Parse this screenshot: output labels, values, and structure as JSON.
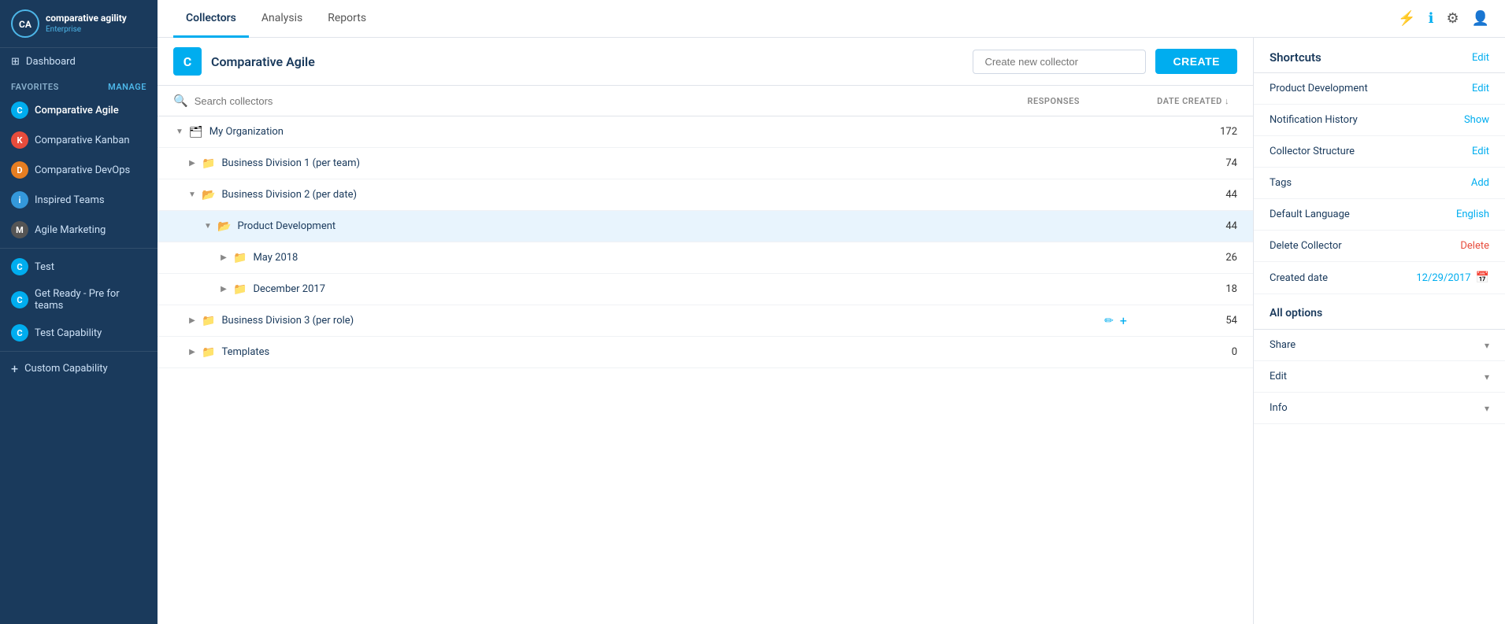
{
  "app": {
    "name": "comparative agility",
    "sub": "Enterprise"
  },
  "sidebar": {
    "dashboard_label": "Dashboard",
    "favorites_label": "FAVORITES",
    "manage_label": "Manage",
    "items": [
      {
        "id": "comparative-agile",
        "label": "Comparative Agile",
        "color": "#00adef",
        "initial": "C"
      },
      {
        "id": "comparative-kanban",
        "label": "Comparative Kanban",
        "color": "#e74c3c",
        "initial": "K"
      },
      {
        "id": "comparative-devops",
        "label": "Comparative DevOps",
        "color": "#e67e22",
        "initial": "D"
      },
      {
        "id": "inspired-teams",
        "label": "Inspired Teams",
        "color": "#3498db",
        "initial": "i"
      },
      {
        "id": "agile-marketing",
        "label": "Agile Marketing",
        "color": "#555",
        "initial": "M"
      }
    ],
    "other_items": [
      {
        "id": "test",
        "label": "Test",
        "color": "#00adef",
        "initial": "C"
      },
      {
        "id": "get-ready",
        "label": "Get Ready - Pre for teams",
        "color": "#00adef",
        "initial": "C"
      },
      {
        "id": "test-capability",
        "label": "Test Capability",
        "color": "#00adef",
        "initial": "C"
      }
    ],
    "add_custom_label": "Custom Capability"
  },
  "top_nav": {
    "tabs": [
      {
        "id": "collectors",
        "label": "Collectors",
        "active": true
      },
      {
        "id": "analysis",
        "label": "Analysis",
        "active": false
      },
      {
        "id": "reports",
        "label": "Reports",
        "active": false
      }
    ],
    "icons": [
      "flash",
      "info",
      "settings",
      "user"
    ]
  },
  "collector_header": {
    "org_initial": "C",
    "org_name": "Comparative Agile",
    "create_input_placeholder": "Create new collector",
    "create_button_label": "CREATE"
  },
  "search": {
    "placeholder": "Search collectors"
  },
  "table": {
    "col_responses": "RESPONSES",
    "col_date": "DATE CREATED ↓"
  },
  "tree": {
    "rows": [
      {
        "id": "my-org",
        "label": "My Organization",
        "responses": 172,
        "indent": 0,
        "expanded": true,
        "has_children": true,
        "show_actions": false
      },
      {
        "id": "biz-div-1",
        "label": "Business Division 1 (per team)",
        "responses": 74,
        "indent": 1,
        "expanded": false,
        "has_children": true,
        "show_actions": false
      },
      {
        "id": "biz-div-2",
        "label": "Business Division 2 (per date)",
        "responses": 44,
        "indent": 1,
        "expanded": true,
        "has_children": true,
        "show_actions": false
      },
      {
        "id": "product-dev",
        "label": "Product Development",
        "responses": 44,
        "indent": 2,
        "expanded": true,
        "has_children": true,
        "selected": true,
        "show_actions": false
      },
      {
        "id": "may-2018",
        "label": "May 2018",
        "responses": 26,
        "indent": 3,
        "expanded": false,
        "has_children": false,
        "show_actions": false
      },
      {
        "id": "dec-2017",
        "label": "December 2017",
        "responses": 18,
        "indent": 3,
        "expanded": false,
        "has_children": false,
        "show_actions": false
      },
      {
        "id": "biz-div-3",
        "label": "Business Division 3 (per role)",
        "responses": 54,
        "indent": 1,
        "expanded": false,
        "has_children": true,
        "show_actions": true
      },
      {
        "id": "templates",
        "label": "Templates",
        "responses": 0,
        "indent": 1,
        "expanded": false,
        "has_children": true,
        "show_actions": false
      }
    ]
  },
  "right_panel": {
    "shortcuts_title": "Shortcuts",
    "shortcuts_edit_label": "Edit",
    "shortcuts": [
      {
        "label": "Product Development",
        "action": "Edit",
        "action_type": "blue"
      },
      {
        "label": "Notification History",
        "action": "Show",
        "action_type": "blue"
      },
      {
        "label": "Collector Structure",
        "action": "Edit",
        "action_type": "blue"
      },
      {
        "label": "Tags",
        "action": "Add",
        "action_type": "blue"
      },
      {
        "label": "Default Language",
        "action": "English",
        "action_type": "blue"
      },
      {
        "label": "Delete Collector",
        "action": "Delete",
        "action_type": "red"
      }
    ],
    "created_date_label": "Created date",
    "created_date_value": "12/29/2017",
    "all_options_label": "All options",
    "expandable_rows": [
      {
        "label": "Share"
      },
      {
        "label": "Edit"
      },
      {
        "label": "Info"
      }
    ]
  }
}
